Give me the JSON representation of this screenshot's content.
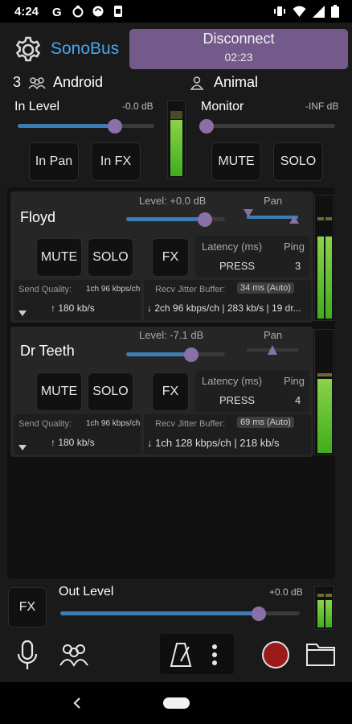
{
  "status_bar": {
    "time": "4:24"
  },
  "header": {
    "app_name": "SonoBus",
    "disconnect_label": "Disconnect",
    "session_time": "02:23"
  },
  "session": {
    "user_count": "3",
    "group_name": "Android",
    "user_name": "Animal"
  },
  "input": {
    "in_level_label": "In Level",
    "in_level_db": "-0.0 dB",
    "in_level": 0.71,
    "monitor_label": "Monitor",
    "monitor_db": "-INF dB",
    "monitor_level": 0.0,
    "in_pan_label": "In Pan",
    "in_fx_label": "In FX",
    "mute_label": "MUTE",
    "solo_label": "SOLO"
  },
  "peers": [
    {
      "name": "Floyd",
      "level_text": "Level: +0.0 dB",
      "level": 0.8,
      "pan_label": "Pan",
      "mute_label": "MUTE",
      "solo_label": "SOLO",
      "fx_label": "FX",
      "latency_label": "Latency (ms)",
      "ping_label": "Ping",
      "latency_value": "PRESS",
      "ping_value": "3",
      "send_quality_label": "Send Quality:",
      "send_quality_value": "1ch 96 kbps/ch",
      "send_rate": "↑ 180 kb/s",
      "jitter_label": "Recv Jitter Buffer:",
      "jitter_value": "34 ms (Auto)",
      "recv_info": "2ch 96 kbps/ch | 283 kb/s | 19 dr..."
    },
    {
      "name": "Dr Teeth",
      "level_text": "Level: -7.1 dB",
      "level": 0.66,
      "pan_label": "Pan",
      "mute_label": "MUTE",
      "solo_label": "SOLO",
      "fx_label": "FX",
      "latency_label": "Latency (ms)",
      "ping_label": "Ping",
      "latency_value": "PRESS",
      "ping_value": "4",
      "send_quality_label": "Send Quality:",
      "send_quality_value": "1ch 96 kbps/ch",
      "send_rate": "↑ 180 kb/s",
      "jitter_label": "Recv Jitter Buffer:",
      "jitter_value": "69 ms (Auto)",
      "recv_info": "1ch 128 kbps/ch | 218 kb/s"
    }
  ],
  "output": {
    "fx_label": "FX",
    "out_level_label": "Out Level",
    "out_level_db": "+0.0 dB",
    "out_level": 0.83
  },
  "colors": {
    "accent_blue": "#4aa7e8",
    "disconnect_bg": "#735a8a",
    "knob": "#8b70a8",
    "slider_fill": "#3c7cb5",
    "meter_green": "#4fc42a",
    "record_red": "#9b1a1a"
  },
  "icons": {
    "settings": "gear-icon",
    "group": "group-icon",
    "user": "user-icon",
    "mic": "mic-icon",
    "peers": "peers-icon",
    "metronome": "metronome-icon",
    "more": "more-vert-icon",
    "record": "record-icon",
    "folder": "folder-icon"
  }
}
